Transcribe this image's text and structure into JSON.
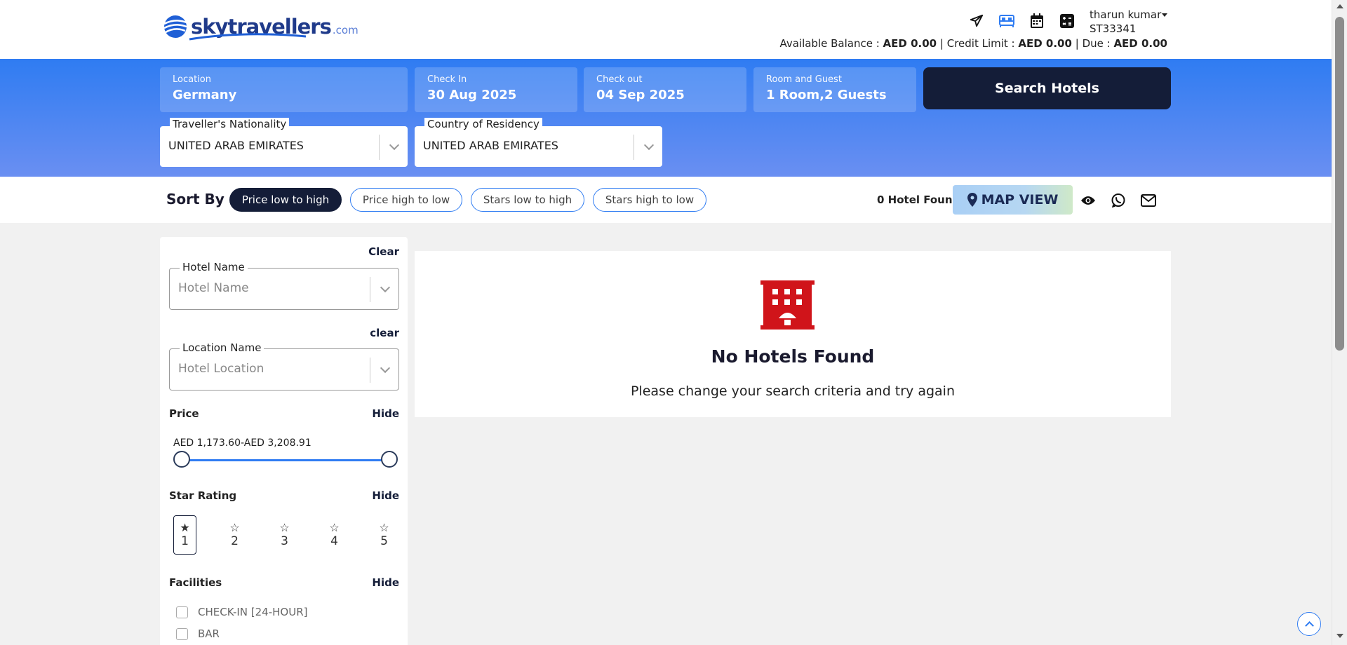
{
  "brand": {
    "name": "skytravellers",
    "domain": ".com"
  },
  "header": {
    "user_name": "tharun kumar",
    "user_id": "ST33341",
    "balance": {
      "available_label": "Available Balance :",
      "available_value": "AED 0.00",
      "credit_label": "Credit Limit :",
      "credit_value": "AED 0.00",
      "due_label": "Due :",
      "due_value": "AED 0.00",
      "sep": "|"
    },
    "icons": [
      "flight-icon",
      "hotel-icon",
      "calendar-icon",
      "calculator-icon"
    ]
  },
  "search": {
    "location_label": "Location",
    "location_value": "Germany",
    "checkin_label": "Check In",
    "checkin_value": "30 Aug 2025",
    "checkout_label": "Check out",
    "checkout_value": "04 Sep 2025",
    "rooms_label": "Room and Guest",
    "rooms_value": "1 Room,2 Guests",
    "button_label": "Search Hotels",
    "nationality_label": "Traveller's Nationality",
    "nationality_value": "UNITED ARAB EMIRATES",
    "residency_label": "Country of Residency",
    "residency_value": "UNITED ARAB EMIRATES"
  },
  "sort": {
    "label": "Sort By :",
    "options": [
      "Price low to high",
      "Price high to low",
      "Stars low to high",
      "Stars high to low"
    ],
    "active_index": 0,
    "found_text": "0 Hotel Found",
    "map_view_label": "MAP VIEW"
  },
  "filters": {
    "clear_label": "Clear",
    "hotel_name_legend": "Hotel Name",
    "hotel_name_placeholder": "Hotel Name",
    "clear_label_lower": "clear",
    "location_legend": "Location Name",
    "location_placeholder": "Hotel Location",
    "price_label": "Price",
    "hide_label": "Hide",
    "price_range": "AED 1,173.60-AED 3,208.91",
    "star_label": "Star Rating",
    "stars": [
      "1",
      "2",
      "3",
      "4",
      "5"
    ],
    "star_selected": "1",
    "facilities_label": "Facilities",
    "facilities": [
      "CHECK-IN [24-HOUR]",
      "BAR"
    ]
  },
  "results": {
    "empty_title": "No Hotels Found",
    "empty_subtitle": "Please change your search criteria and try again"
  },
  "colors": {
    "primary": "#2f7cf2",
    "dark": "#141d38",
    "empty_icon": "#d0141a"
  }
}
